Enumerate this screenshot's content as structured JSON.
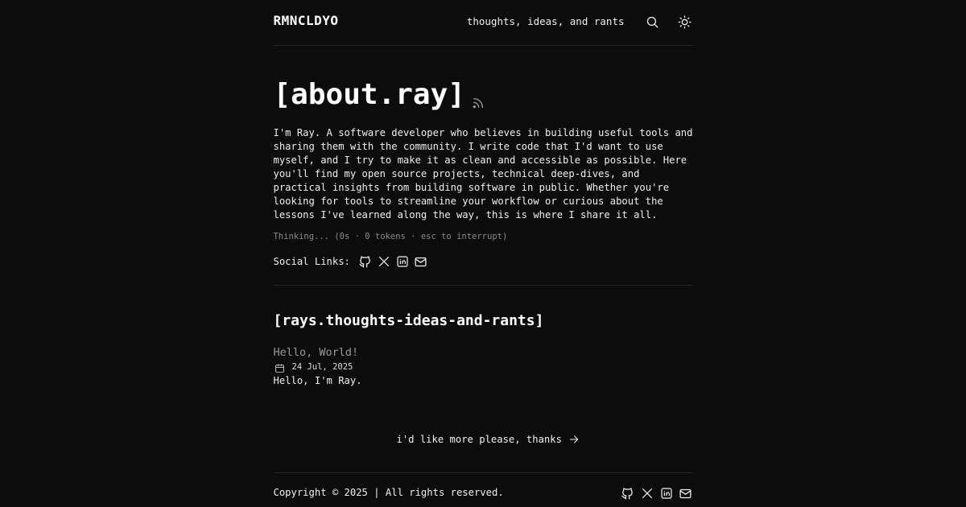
{
  "header": {
    "brand": "RMNCLDYO",
    "nav_link": "thoughts, ideas, and rants",
    "search_icon": "search-icon",
    "theme_icon": "sun-icon"
  },
  "about": {
    "title": "[about.ray]",
    "rss_icon": "rss-icon",
    "bio": "I'm Ray. A software developer who believes in building useful tools and sharing them with the community. I write code that I'd want to use myself, and I try to make it as clean and accessible as possible. Here you'll find my open source projects, technical deep-dives, and practical insights from building software in public. Whether you're looking for tools to streamline your workflow or curious about the lessons I've learned along the way, this is where I share it all.",
    "thinking": "Thinking... (0s · 0 tokens · esc to interrupt)",
    "social_label": "Social Links:",
    "social_icons": [
      "github-icon",
      "x-icon",
      "linkedin-icon",
      "mail-icon"
    ]
  },
  "posts_section": {
    "title": "[rays.thoughts-ideas-and-rants]",
    "posts": [
      {
        "title": "Hello, World!",
        "date": "24 Jul, 2025",
        "excerpt": "Hello, I'm Ray."
      }
    ],
    "more_link": "i'd like more please, thanks"
  },
  "footer": {
    "copyright": "Copyright © 2025 | All rights reserved."
  },
  "colors": {
    "background": "#0c0c0c",
    "text": "#f2f2f2",
    "muted": "#8a8a8a",
    "divider": "#222222"
  }
}
